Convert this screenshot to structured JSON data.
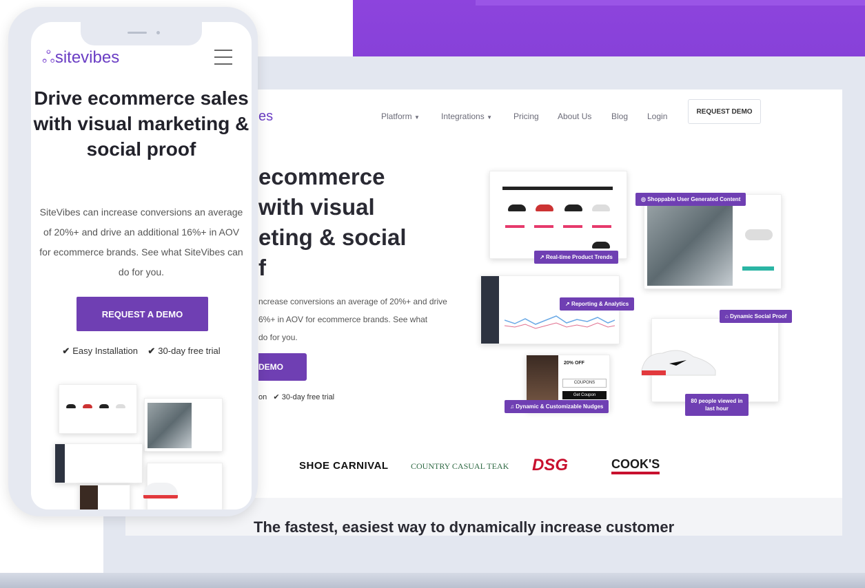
{
  "phone": {
    "logo_text": "sitevibes",
    "title": "Drive ecommerce sales with visual marketing & social proof",
    "description": "SiteVibes can increase conversions an average of 20%+ and drive an additional 16%+ in AOV for ecommerce brands. See what SiteVibes can do for you.",
    "cta": "REQUEST A DEMO",
    "checks": [
      "Easy Installation",
      "30-day free trial"
    ]
  },
  "laptop": {
    "logo_fragment": "es",
    "nav": [
      {
        "label": "Platform",
        "dropdown": true
      },
      {
        "label": "Integrations",
        "dropdown": true
      },
      {
        "label": "Pricing",
        "dropdown": false
      },
      {
        "label": "About Us",
        "dropdown": false
      },
      {
        "label": "Blog",
        "dropdown": false
      },
      {
        "label": "Login",
        "dropdown": false
      }
    ],
    "request_demo": "REQUEST DEMO",
    "hero_title_lines": [
      "ecommerce",
      "with visual",
      "eting & social",
      "f"
    ],
    "hero_desc_lines": [
      "ncrease conversions an average of 20%+ and drive",
      "6%+ in AOV for ecommerce brands. See what",
      "do for you."
    ],
    "hero_cta": "DEMO",
    "hero_checks": [
      "on",
      "30-day free trial"
    ],
    "collage_tags": {
      "ugc": "Shoppable User Generated Content",
      "trends": "Real-time Product Trends",
      "reporting": "Reporting & Analytics",
      "social_proof": "Dynamic Social Proof",
      "nudges": "Dynamic & Customizable Nudges",
      "viewed": "80 people viewed in last hour"
    },
    "nudge_card": {
      "offer": "20% OFF",
      "button1": "COUPONS",
      "button2": "Get Coupon"
    },
    "logos": {
      "shoe": "SHOE CARNIVAL",
      "country": "COUNTRY CASUAL TEAK",
      "dsg": "DSG",
      "cooks": "COOK'S"
    },
    "bottom_heading": "The fastest, easiest way to dynamically increase customer"
  },
  "colors": {
    "brand_purple": "#6f3fb3",
    "background_purple": "#8d44dd"
  }
}
